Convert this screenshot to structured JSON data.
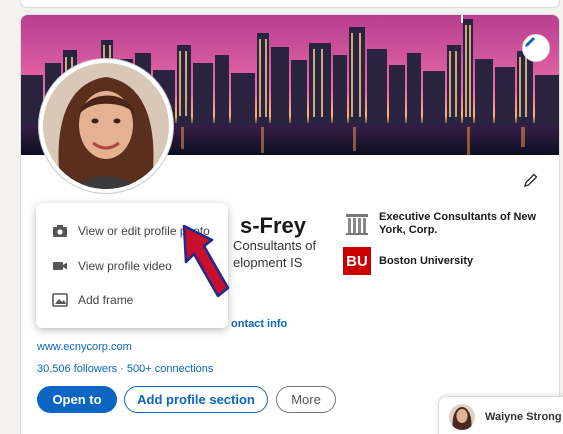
{
  "profile": {
    "name_partial": "s-Frey",
    "headline_line1": "Consultants of",
    "headline_line2": "elopment IS",
    "contact_info_partial": "ontact info",
    "website": "www.ecnycorp.com",
    "followers_connections": "30,506 followers · 500+ connections"
  },
  "photo_menu": {
    "items": [
      {
        "label": "View or edit profile photo",
        "icon": "camera-icon"
      },
      {
        "label": "View profile video",
        "icon": "video-icon"
      },
      {
        "label": "Add frame",
        "icon": "image-icon"
      }
    ]
  },
  "experience": {
    "company": "Executive Consultants of New York, Corp.",
    "company_logo": "columns-logo-icon",
    "school": "Boston University",
    "school_logo_text": "BU"
  },
  "actions": {
    "open_to": "Open to",
    "add_section": "Add profile section",
    "more": "More"
  },
  "chat": {
    "name_partial": "Waiyne Strong"
  },
  "colors": {
    "brand_blue": "#0a66c2",
    "bu_red": "#cc0000",
    "annotation_arrow": "#c8102e"
  }
}
